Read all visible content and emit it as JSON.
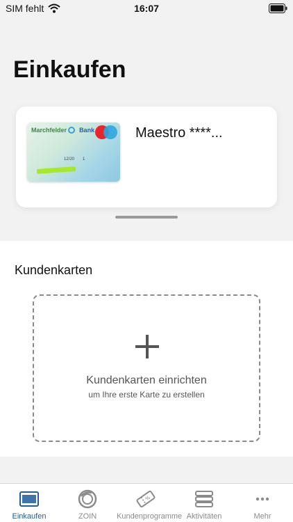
{
  "status_bar": {
    "carrier": "SIM fehlt",
    "time": "16:07"
  },
  "page_title": "Einkaufen",
  "payment_card": {
    "label": "Maestro ****...",
    "image": {
      "bank_name_part1": "Marchfelder",
      "bank_name_part2": "Bank",
      "expiry": "12/20",
      "mark": "1"
    }
  },
  "loyalty_section": {
    "title": "Kundenkarten",
    "add_card": {
      "title": "Kundenkarten einrichten",
      "subtitle": "um Ihre erste Karte zu erstellen"
    }
  },
  "tab_bar": {
    "active": "Einkaufen",
    "items": [
      {
        "label": "Einkaufen",
        "icon": "card-icon"
      },
      {
        "label": "ZOIN",
        "icon": "zoin-icon"
      },
      {
        "label": "Kundenprogramme",
        "icon": "ticket-icon"
      },
      {
        "label": "Aktivitäten",
        "icon": "activity-icon"
      },
      {
        "label": "Mehr",
        "icon": "more-icon"
      }
    ]
  },
  "colors": {
    "accent": "#1f5b9e",
    "inactive": "#8a8a8a",
    "background": "#f2f2f2"
  }
}
